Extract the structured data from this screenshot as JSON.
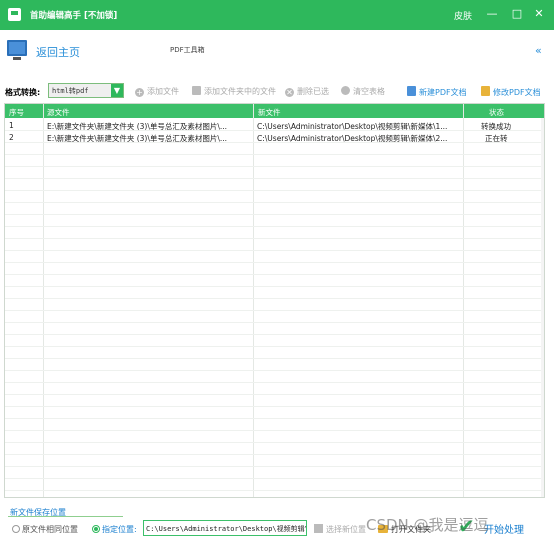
{
  "titlebar": {
    "title": "首助编辑高手 [不加锁]",
    "skin": "皮肤",
    "minimize_icon": "minimize-icon",
    "maximize_icon": "maximize-icon",
    "close_icon": "close-icon",
    "color": "#2eb85c"
  },
  "topbar": {
    "back_home": "返回主页",
    "page_label": "PDF工具箱",
    "collapse_glyph": "«"
  },
  "toolbar": {
    "format_label": "格式转换:",
    "format_value": "html转pdf",
    "add_file": "添加文件",
    "add_folder_files": "添加文件夹中的文件",
    "delete_selected": "删除已选",
    "clear_table": "清空表格",
    "new_pdf": "新建PDF文档",
    "edit_pdf": "修改PDF文档"
  },
  "table": {
    "columns": [
      "序号",
      "源文件",
      "新文件",
      "状态"
    ],
    "rows": [
      {
        "index": "1",
        "source": "E:\\新建文件夹\\新建文件夹 (3)\\单号总汇及素材图片\\...",
        "target": "C:\\Users\\Administrator\\Desktop\\视频剪辑\\新媒体\\1...",
        "status": "转换成功"
      },
      {
        "index": "2",
        "source": "E:\\新建文件夹\\新建文件夹 (3)\\单号总汇及素材图片\\...",
        "target": "C:\\Users\\Administrator\\Desktop\\视频剪辑\\新媒体\\2...",
        "status": "正在转"
      }
    ]
  },
  "save": {
    "title": "新文件保存位置",
    "option_same": "原文件相同位置",
    "option_custom": "指定位置:",
    "path": "C:\\Users\\Administrator\\Desktop\\视频剪辑\\新",
    "choose_location": "选择新位置",
    "open_folder": "打开文件夹",
    "start": "开始处理"
  },
  "watermark": "CSDN @我是逗逗"
}
